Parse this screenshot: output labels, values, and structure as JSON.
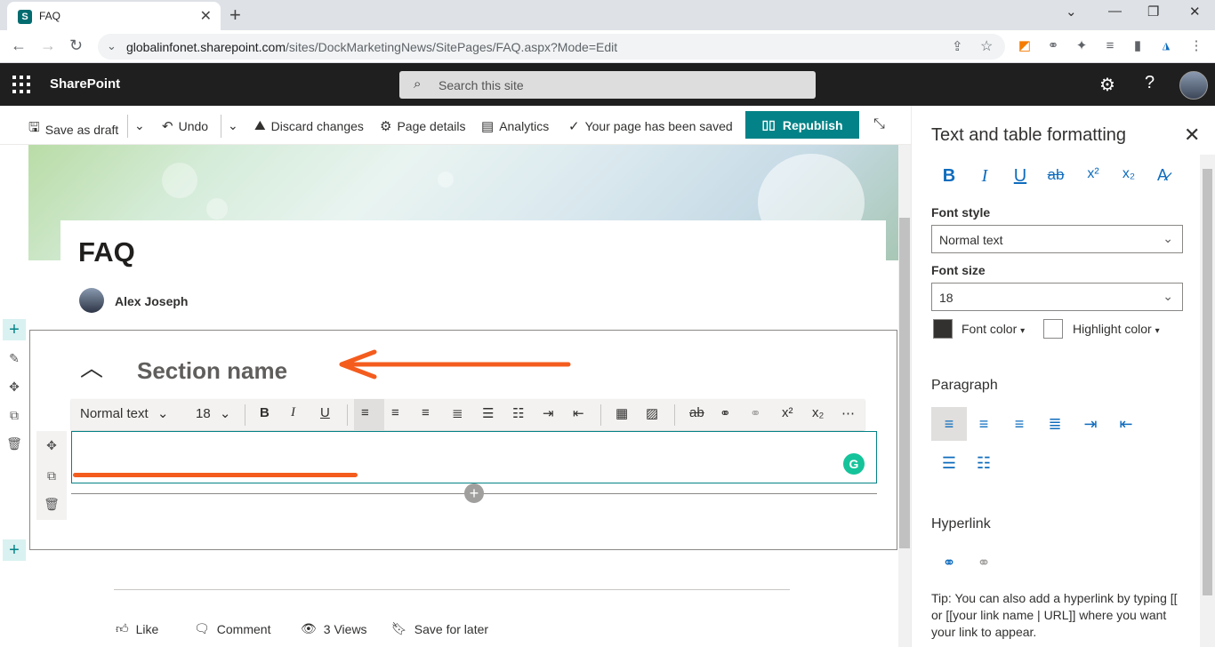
{
  "browser": {
    "tab_title": "FAQ",
    "url_host": "globalinfonet.sharepoint.com",
    "url_path": "/sites/DockMarketingNews/SitePages/FAQ.aspx?Mode=Edit"
  },
  "suite": {
    "brand": "SharePoint",
    "search_placeholder": "Search this site"
  },
  "commands": {
    "save_draft": "Save as draft",
    "undo": "Undo",
    "discard": "Discard changes",
    "page_details": "Page details",
    "analytics": "Analytics",
    "saved_status": "Your page has been saved",
    "republish": "Republish"
  },
  "page": {
    "title": "FAQ",
    "author": "Alex Joseph",
    "section_name": "Section name"
  },
  "toolbar": {
    "style": "Normal text",
    "size": "18"
  },
  "social": {
    "like": "Like",
    "comment": "Comment",
    "views": "3 Views",
    "save": "Save for later"
  },
  "panel": {
    "title": "Text and table formatting",
    "font_style_label": "Font style",
    "font_style_value": "Normal text",
    "font_size_label": "Font size",
    "font_size_value": "18",
    "font_color": "Font color",
    "highlight_color": "Highlight color",
    "paragraph": "Paragraph",
    "hyperlink": "Hyperlink",
    "tip": "Tip: You can also add a hyperlink by typing [[ or [[your link name | URL]] where you want your link to appear."
  },
  "colors": {
    "accent": "#038387",
    "annotation": "#f45c1e",
    "suite_bar": "#1f1f1f",
    "font_color_swatch": "#323130",
    "highlight_swatch": "#ffffff"
  }
}
